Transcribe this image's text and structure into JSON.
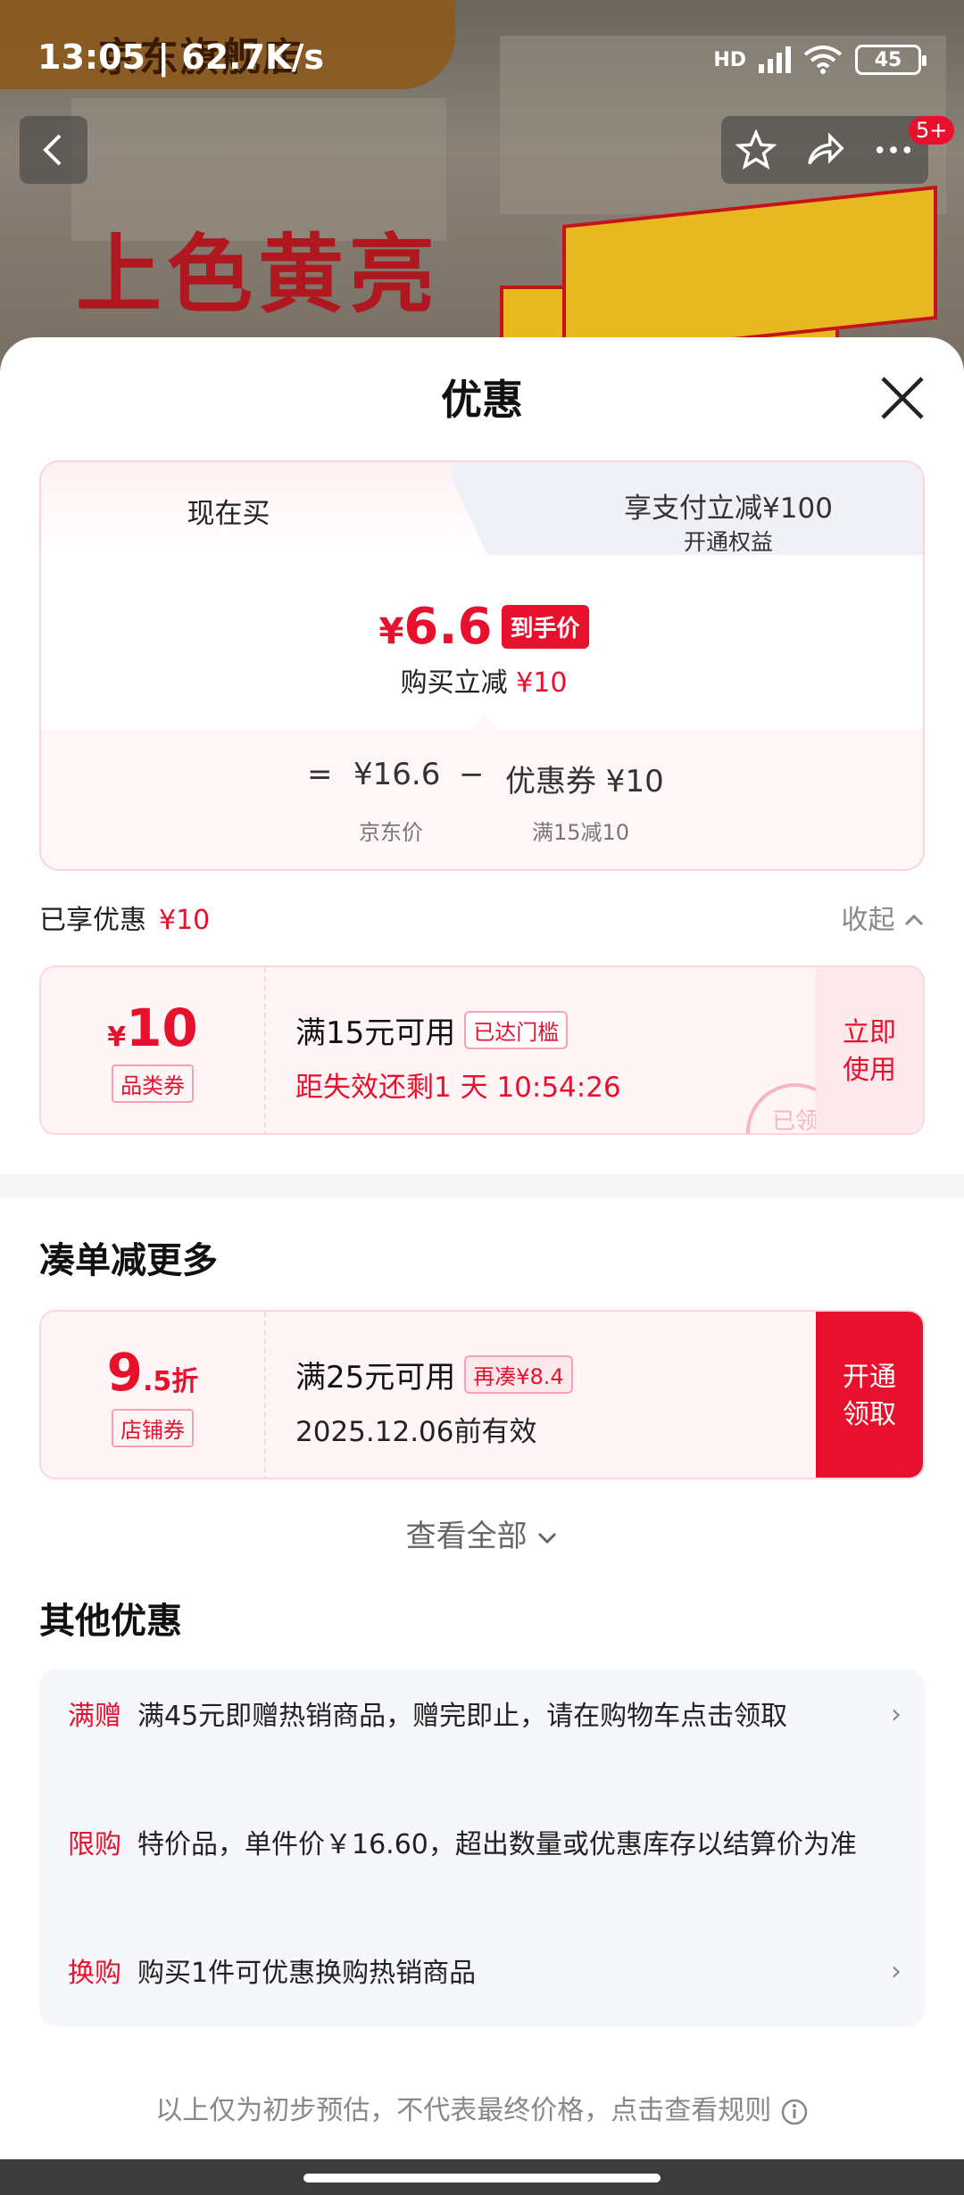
{
  "status_bar": {
    "time_speed": "13:05 | 62.7K/s",
    "network": "HD",
    "battery": "45"
  },
  "background": {
    "shop_name": "京东旗舰店",
    "slogan": "上色黄亮",
    "badge": "5+"
  },
  "sheet": {
    "title": "优惠",
    "tabs": [
      {
        "label": "现在买"
      },
      {
        "label": "享支付立减¥100",
        "sub": "开通权益"
      }
    ],
    "price": {
      "yen": "¥",
      "amount": "6.6",
      "tag": "到手价",
      "sub_label": "购买立减",
      "sub_value": "¥10"
    },
    "calc": {
      "eq": "=",
      "jd_price": "¥16.6",
      "minus": "−",
      "coupon": "优惠券 ¥10",
      "jd_label": "京东价",
      "coupon_label": "满15减10"
    },
    "enjoyed": {
      "label": "已享优惠",
      "value": "¥10",
      "collapse": "收起"
    },
    "coupon1": {
      "yen": "¥",
      "value": "10",
      "kind": "品类券",
      "condition": "满15元可用",
      "pill": "已达门槛",
      "countdown": "距失效还剩1 天 10:54:26",
      "action": "立即使用",
      "stamp": "已领"
    },
    "more_section": {
      "title": "凑单减更多"
    },
    "coupon2": {
      "value": "9",
      "unit": ".5折",
      "kind": "店铺券",
      "condition": "满25元可用",
      "pill": "再凑¥8.4",
      "expiry": "2025.12.06前有效",
      "action": "开通领取"
    },
    "view_all": "查看全部",
    "other": {
      "title": "其他优惠",
      "items": [
        {
          "key": "满赠",
          "text": "满45元即赠热销商品，赠完即止，请在购物车点击领取"
        },
        {
          "key": "限购",
          "text": "特价品，单件价￥16.60，超出数量或优惠库存以结算价为准"
        },
        {
          "key": "换购",
          "text": "购买1件可优惠换购热销商品"
        }
      ]
    },
    "footer": "以上仅为初步预估，不代表最终价格，点击查看规则"
  }
}
